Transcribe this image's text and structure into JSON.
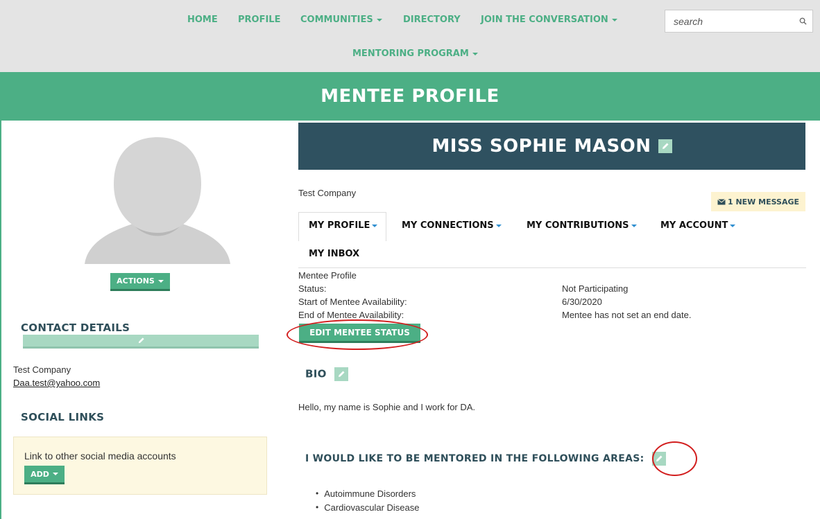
{
  "nav": {
    "items": [
      {
        "label": "HOME",
        "dropdown": false
      },
      {
        "label": "PROFILE",
        "dropdown": false
      },
      {
        "label": "COMMUNITIES",
        "dropdown": true
      },
      {
        "label": "DIRECTORY",
        "dropdown": false
      },
      {
        "label": "JOIN THE CONVERSATION",
        "dropdown": true
      },
      {
        "label": "MENTORING PROGRAM",
        "dropdown": true
      }
    ],
    "search_placeholder": "search",
    "search_icon": "search-icon"
  },
  "banner": {
    "title": "MENTEE PROFILE"
  },
  "sidebar": {
    "avatar_icon": "avatar-placeholder-icon",
    "actions_label": "ACTIONS",
    "contact": {
      "title": "CONTACT DETAILS",
      "company": "Test Company",
      "email": "Daa.test@yahoo.com"
    },
    "social": {
      "title": "SOCIAL LINKS",
      "text": "Link to other social media accounts",
      "add_label": "ADD"
    }
  },
  "profile": {
    "name": "MISS SOPHIE MASON",
    "company": "Test Company",
    "new_message": "1 NEW MESSAGE",
    "tabs": [
      {
        "label": "MY PROFILE",
        "active": true
      },
      {
        "label": "MY CONNECTIONS",
        "active": false
      },
      {
        "label": "MY CONTRIBUTIONS",
        "active": false
      },
      {
        "label": "MY ACCOUNT",
        "active": false
      },
      {
        "label": "MY INBOX",
        "active": false
      }
    ],
    "mentee": {
      "heading": "Mentee Profile",
      "rows": [
        {
          "label": "Status:",
          "value": "Not Participating"
        },
        {
          "label": "Start of Mentee Availability:",
          "value": "6/30/2020"
        },
        {
          "label": "End of Mentee Availability:",
          "value": "Mentee has not set an end date."
        }
      ],
      "edit_status_label": "EDIT MENTEE STATUS"
    },
    "bio": {
      "title": "BIO",
      "text": "Hello, my name is Sophie and I work for DA."
    },
    "mentoring": {
      "title": "I WOULD LIKE TO BE MENTORED IN THE FOLLOWING AREAS:",
      "areas": [
        "Autoimmune Disorders",
        "Cardiovascular Disease"
      ]
    }
  },
  "colors": {
    "brand_green": "#4caf85",
    "dark_teal": "#2f5160",
    "light_green": "#a8d8c2",
    "highlight_red": "#d21e1e"
  }
}
